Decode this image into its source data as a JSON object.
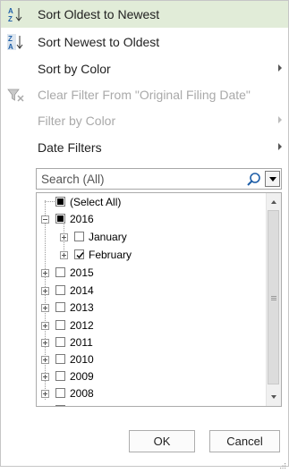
{
  "menu": {
    "sort_oldest": "Sort Oldest to Newest",
    "sort_newest": "Sort Newest to Oldest",
    "sort_color": "Sort by Color",
    "clear_filter": "Clear Filter From \"Original Filing Date\"",
    "filter_color": "Filter by Color",
    "date_filters": "Date Filters"
  },
  "search": {
    "value": "Search (All)"
  },
  "tree": {
    "select_all": "(Select All)",
    "year_2016": "2016",
    "month_jan": "January",
    "month_feb": "February",
    "years": [
      "2015",
      "2014",
      "2013",
      "2012",
      "2011",
      "2010",
      "2009",
      "2008"
    ]
  },
  "buttons": {
    "ok": "OK",
    "cancel": "Cancel"
  },
  "colors": {
    "highlight": "#e1ecd8",
    "disabled_text": "#a9a9a9"
  }
}
